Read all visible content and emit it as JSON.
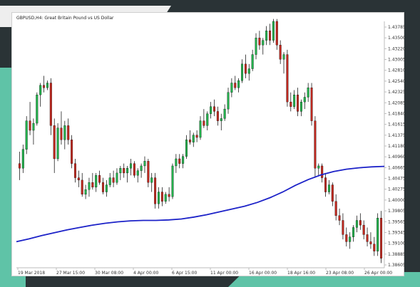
{
  "chart_data": {
    "type": "candlestick",
    "title": "GBPUSD,H4: Great Britain Pound vs US Dollar",
    "colors": {
      "bull": "#22b14c",
      "bear": "#c0281f",
      "wick": "#000000",
      "ma": "#1c22c8",
      "axis": "#bdbdbd",
      "background": "#ffffff"
    },
    "y_ticks": [
      "1.43785",
      "1.43500",
      "1.43220",
      "1.43005",
      "1.42810",
      "1.42540",
      "1.42325",
      "1.42085",
      "1.41840",
      "1.41615",
      "1.41375",
      "1.41180",
      "1.40960",
      "1.40665",
      "1.40475",
      "1.40275",
      "1.40000",
      "1.39805",
      "1.39565",
      "1.39345",
      "1.39100",
      "1.38885",
      "1.38605"
    ],
    "ylim": [
      1.386,
      1.438
    ],
    "x_ticks": [
      "19 Mar 2018",
      "27 Mar 15:00",
      "30 Mar 08:00",
      "4 Apr 00:00",
      "6 Apr 15:00",
      "11 Apr 00:00",
      "16 Apr 00:00",
      "18 Apr 16:00",
      "23 Apr 08:00",
      "26 Apr 00:00"
    ],
    "candles": [
      [
        1.408,
        1.4105,
        1.4045,
        1.407
      ],
      [
        1.407,
        1.412,
        1.406,
        1.411
      ],
      [
        1.411,
        1.418,
        1.41,
        1.417
      ],
      [
        1.417,
        1.421,
        1.414,
        1.415
      ],
      [
        1.415,
        1.4175,
        1.412,
        1.4165
      ],
      [
        1.4165,
        1.423,
        1.416,
        1.4225
      ],
      [
        1.4225,
        1.425,
        1.42,
        1.4245
      ],
      [
        1.4245,
        1.4265,
        1.423,
        1.424
      ],
      [
        1.424,
        1.4255,
        1.4235,
        1.425
      ],
      [
        1.425,
        1.426,
        1.414,
        1.416
      ],
      [
        1.416,
        1.4175,
        1.406,
        1.409
      ],
      [
        1.409,
        1.4165,
        1.4085,
        1.4155
      ],
      [
        1.4155,
        1.419,
        1.412,
        1.413
      ],
      [
        1.413,
        1.417,
        1.411,
        1.416
      ],
      [
        1.416,
        1.4175,
        1.412,
        1.413
      ],
      [
        1.413,
        1.414,
        1.407,
        1.408
      ],
      [
        1.408,
        1.409,
        1.404,
        1.405
      ],
      [
        1.405,
        1.4065,
        1.403,
        1.4045
      ],
      [
        1.4045,
        1.406,
        1.401,
        1.4015
      ],
      [
        1.4015,
        1.4035,
        1.4005,
        1.4025
      ],
      [
        1.4025,
        1.405,
        1.401,
        1.404
      ],
      [
        1.404,
        1.406,
        1.4025,
        1.403
      ],
      [
        1.403,
        1.406,
        1.402,
        1.4055
      ],
      [
        1.4055,
        1.4065,
        1.4035,
        1.404
      ],
      [
        1.404,
        1.405,
        1.4015,
        1.402
      ],
      [
        1.402,
        1.4045,
        1.401,
        1.4035
      ],
      [
        1.4035,
        1.406,
        1.403,
        1.405
      ],
      [
        1.405,
        1.4065,
        1.403,
        1.404
      ],
      [
        1.404,
        1.407,
        1.4035,
        1.406
      ],
      [
        1.406,
        1.4075,
        1.4045,
        1.407
      ],
      [
        1.407,
        1.408,
        1.405,
        1.406
      ],
      [
        1.406,
        1.4075,
        1.404,
        1.407
      ],
      [
        1.407,
        1.409,
        1.4055,
        1.408
      ],
      [
        1.408,
        1.4085,
        1.405,
        1.4055
      ],
      [
        1.4055,
        1.407,
        1.404,
        1.4065
      ],
      [
        1.4065,
        1.408,
        1.405,
        1.4075
      ],
      [
        1.4075,
        1.4095,
        1.406,
        1.4085
      ],
      [
        1.4085,
        1.409,
        1.403,
        1.404
      ],
      [
        1.404,
        1.406,
        1.402,
        1.405
      ],
      [
        1.405,
        1.406,
        1.3985,
        1.3995
      ],
      [
        1.3995,
        1.403,
        1.3985,
        1.402
      ],
      [
        1.402,
        1.403,
        1.399,
        1.4
      ],
      [
        1.4,
        1.402,
        1.3995,
        1.4015
      ],
      [
        1.4015,
        1.403,
        1.4,
        1.401
      ],
      [
        1.401,
        1.408,
        1.4005,
        1.4075
      ],
      [
        1.4075,
        1.41,
        1.406,
        1.409
      ],
      [
        1.409,
        1.41,
        1.407,
        1.408
      ],
      [
        1.408,
        1.41,
        1.407,
        1.4095
      ],
      [
        1.4095,
        1.414,
        1.409,
        1.413
      ],
      [
        1.413,
        1.415,
        1.412,
        1.4125
      ],
      [
        1.4125,
        1.4145,
        1.4115,
        1.414
      ],
      [
        1.414,
        1.415,
        1.4125,
        1.4135
      ],
      [
        1.4135,
        1.418,
        1.413,
        1.417
      ],
      [
        1.417,
        1.4195,
        1.4155,
        1.416
      ],
      [
        1.416,
        1.419,
        1.415,
        1.4185
      ],
      [
        1.4185,
        1.421,
        1.4175,
        1.42
      ],
      [
        1.42,
        1.4215,
        1.418,
        1.419
      ],
      [
        1.419,
        1.42,
        1.416,
        1.417
      ],
      [
        1.417,
        1.4185,
        1.415,
        1.4175
      ],
      [
        1.4175,
        1.4205,
        1.417,
        1.4195
      ],
      [
        1.4195,
        1.424,
        1.4185,
        1.423
      ],
      [
        1.423,
        1.426,
        1.422,
        1.425
      ],
      [
        1.425,
        1.4265,
        1.4235,
        1.424
      ],
      [
        1.424,
        1.426,
        1.423,
        1.4255
      ],
      [
        1.4255,
        1.43,
        1.425,
        1.429
      ],
      [
        1.429,
        1.431,
        1.426,
        1.427
      ],
      [
        1.427,
        1.429,
        1.4255,
        1.428
      ],
      [
        1.428,
        1.432,
        1.4275,
        1.431
      ],
      [
        1.431,
        1.4355,
        1.43,
        1.4345
      ],
      [
        1.4345,
        1.436,
        1.432,
        1.433
      ],
      [
        1.433,
        1.4345,
        1.431,
        1.434
      ],
      [
        1.434,
        1.437,
        1.433,
        1.436
      ],
      [
        1.436,
        1.4375,
        1.433,
        1.434
      ],
      [
        1.434,
        1.4385,
        1.4335,
        1.438
      ],
      [
        1.438,
        1.4385,
        1.432,
        1.433
      ],
      [
        1.433,
        1.434,
        1.429,
        1.43
      ],
      [
        1.43,
        1.4315,
        1.427,
        1.431
      ],
      [
        1.431,
        1.432,
        1.42,
        1.421
      ],
      [
        1.421,
        1.423,
        1.419,
        1.42
      ],
      [
        1.42,
        1.4235,
        1.4195,
        1.4225
      ],
      [
        1.4225,
        1.424,
        1.418,
        1.419
      ],
      [
        1.419,
        1.4215,
        1.418,
        1.421
      ],
      [
        1.421,
        1.423,
        1.4195,
        1.422
      ],
      [
        1.422,
        1.425,
        1.421,
        1.424
      ],
      [
        1.424,
        1.425,
        1.416,
        1.417
      ],
      [
        1.417,
        1.418,
        1.405,
        1.407
      ],
      [
        1.407,
        1.408,
        1.4055,
        1.4075
      ],
      [
        1.4075,
        1.408,
        1.404,
        1.405
      ],
      [
        1.405,
        1.406,
        1.401,
        1.402
      ],
      [
        1.402,
        1.4045,
        1.4015,
        1.4035
      ],
      [
        1.4035,
        1.404,
        1.399,
        1.4
      ],
      [
        1.4,
        1.4015,
        1.396,
        1.397
      ],
      [
        1.397,
        1.3985,
        1.395,
        1.396
      ],
      [
        1.396,
        1.3975,
        1.392,
        1.393
      ],
      [
        1.393,
        1.3945,
        1.3905,
        1.3915
      ],
      [
        1.3915,
        1.3935,
        1.39,
        1.3925
      ],
      [
        1.3925,
        1.395,
        1.3915,
        1.3945
      ],
      [
        1.3945,
        1.397,
        1.3935,
        1.396
      ],
      [
        1.396,
        1.3975,
        1.394,
        1.395
      ],
      [
        1.395,
        1.396,
        1.392,
        1.393
      ],
      [
        1.393,
        1.3945,
        1.3905,
        1.3915
      ],
      [
        1.3915,
        1.3935,
        1.39,
        1.391
      ],
      [
        1.391,
        1.3925,
        1.3885,
        1.3895
      ],
      [
        1.3895,
        1.3975,
        1.3885,
        1.3965
      ],
      [
        1.3965,
        1.398,
        1.387,
        1.388
      ]
    ],
    "moving_average": [
      1.3915,
      1.3921,
      1.3928,
      1.3934,
      1.394,
      1.3945,
      1.395,
      1.3954,
      1.3957,
      1.3959,
      1.396,
      1.396,
      1.3961,
      1.3963,
      1.3967,
      1.3972,
      1.3978,
      1.3984,
      1.399,
      1.3998,
      1.4008,
      1.402,
      1.4034,
      1.4046,
      1.4056,
      1.4063,
      1.4068,
      1.4071,
      1.4073,
      1.4074
    ]
  }
}
